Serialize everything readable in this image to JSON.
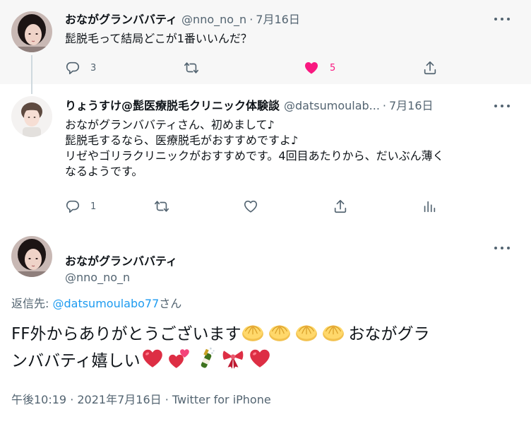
{
  "tweet1": {
    "user_name": "おながグランババティ",
    "handle": "@nno_no_n",
    "separator": "·",
    "date": "7月16日",
    "text": "髭脱毛って結局どこが1番いいんだ？",
    "replies": "3",
    "likes": "5",
    "like_color": "#f91880"
  },
  "tweet2": {
    "user_name": "りょうすけ@髭医療脱毛クリニック体験談",
    "handle": "@datsumoulab...",
    "separator": "·",
    "date": "7月16日",
    "lines": [
      "おながグランババティさん、初めまして♪",
      "髭脱毛するなら、医療脱毛がおすすめですよ♪",
      "リゼやゴリラクリニックがおすすめです。4回目あたりから、だいぶん薄く",
      "なるようです。"
    ],
    "replies": "1"
  },
  "tweet3": {
    "user_name": "おながグランババティ",
    "handle": "@nno_no_n",
    "reply_prefix": "返信先: ",
    "reply_link": "@datsumoulabo77",
    "reply_suffix": "さん",
    "line1": "FF外からありがとうございます",
    "line1_tail": "おながグラ",
    "line2": "ンババティ嬉しい",
    "timestamp": "午後10:19 · 2021年7月16日 · ",
    "source": "Twitter for iPhone"
  },
  "icons": [
    "reply-icon",
    "retweet-icon",
    "like-icon",
    "share-icon",
    "analytics-icon",
    "more-icon",
    "bun-emoji",
    "heart-emoji",
    "two-hearts-emoji",
    "champagne-emoji",
    "ribbon-emoji"
  ],
  "colors": {
    "secondary": "#536471",
    "link": "#1d9bf0",
    "thread_line": "#cfd9de",
    "background_highlight": "#f7f7f7"
  }
}
